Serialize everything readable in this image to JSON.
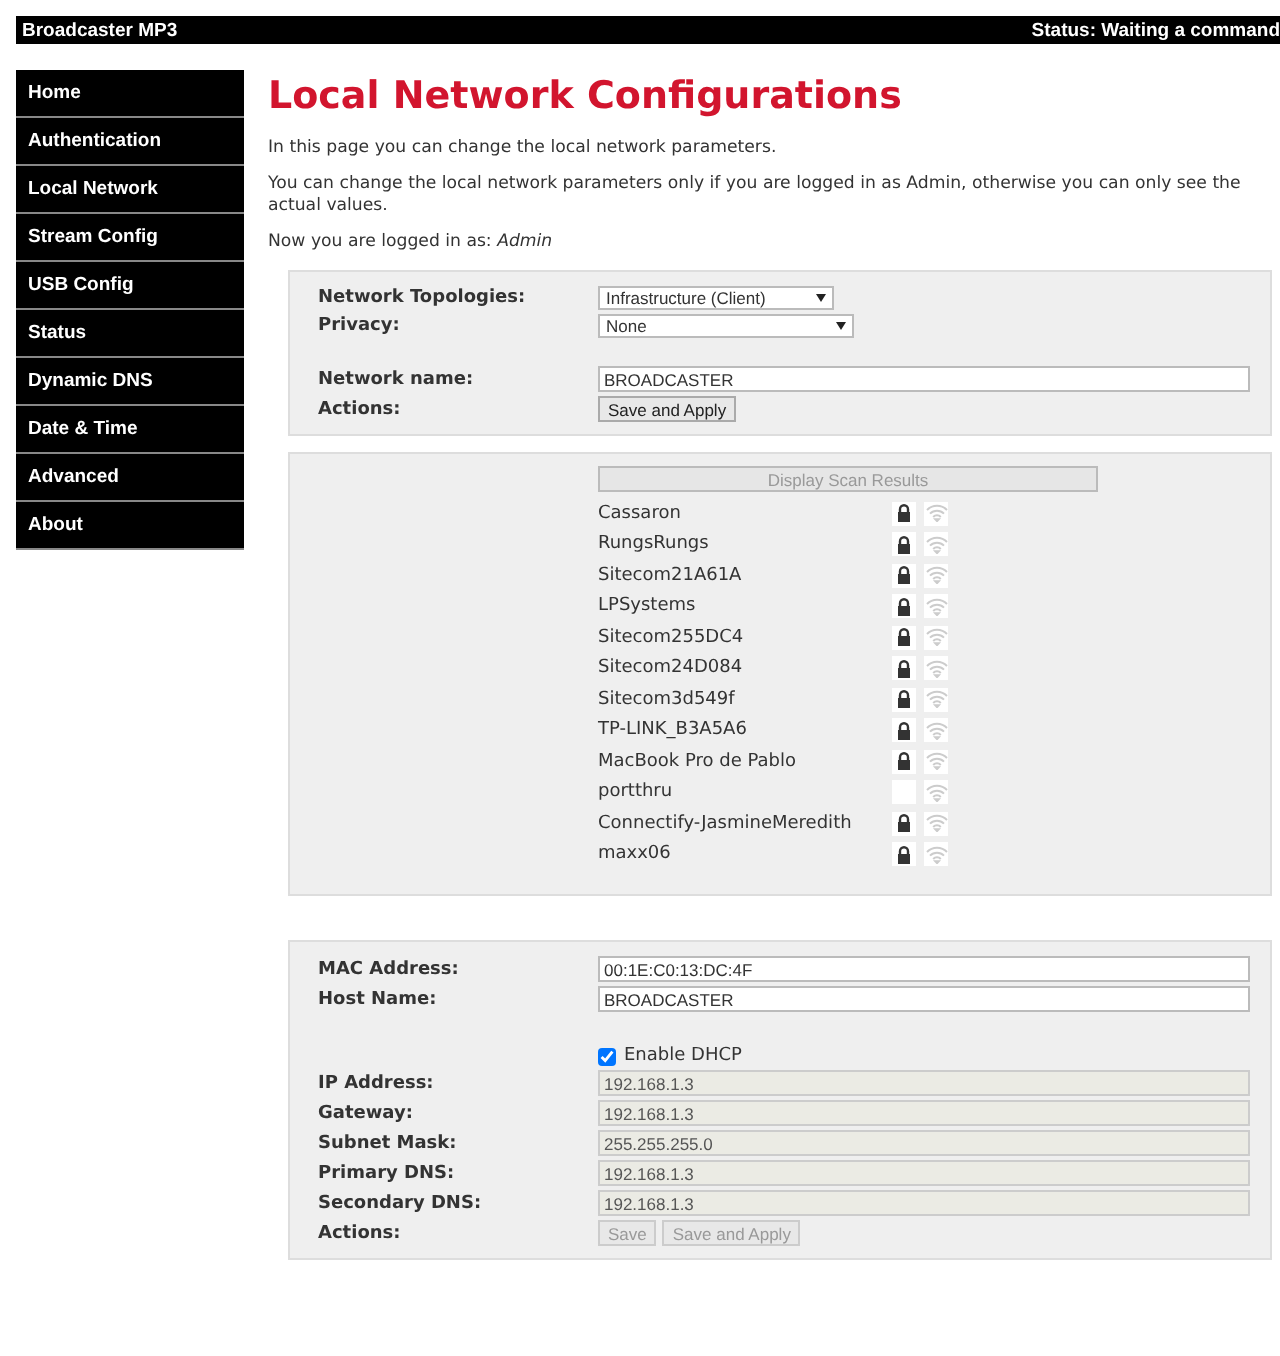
{
  "header": {
    "title": "Broadcaster MP3",
    "status": "Status:  Waiting a command"
  },
  "sidebar": {
    "items": [
      {
        "label": "Home"
      },
      {
        "label": "Authentication"
      },
      {
        "label": "Local Network"
      },
      {
        "label": "Stream Config"
      },
      {
        "label": "USB Config"
      },
      {
        "label": "Status"
      },
      {
        "label": "Dynamic DNS"
      },
      {
        "label": "Date & Time"
      },
      {
        "label": "Advanced"
      },
      {
        "label": "About"
      }
    ]
  },
  "page": {
    "title": "Local Network Configurations",
    "intro": [
      "In this page you can change the local network parameters.",
      "You can change the local network parameters only if you are logged in as Admin, otherwise you can only see the actual values."
    ],
    "login_label": "Now you are logged in as:",
    "login_user": "Admin"
  },
  "network_panel": {
    "groups": [
      [
        {
          "kind": "select",
          "label": "Network Topologies:",
          "value": "Infrastructure (Client)",
          "wide": false
        },
        {
          "kind": "select",
          "label": "Privacy:",
          "value": "None",
          "wide": true
        }
      ],
      [
        {
          "kind": "input",
          "label": "Network name:",
          "value": "BROADCASTER",
          "disabled": false
        },
        {
          "kind": "buttons",
          "label": "Actions:",
          "buttons": [
            {
              "label": "Save and Apply",
              "disabled": false
            }
          ]
        }
      ]
    ]
  },
  "scan_panel": {
    "button": {
      "label": "Display Scan Results",
      "disabled": true
    },
    "networks": [
      {
        "ssid": "Cassaron",
        "secured": true
      },
      {
        "ssid": "RungsRungs",
        "secured": true
      },
      {
        "ssid": "Sitecom21A61A",
        "secured": true
      },
      {
        "ssid": "LPSystems",
        "secured": true
      },
      {
        "ssid": "Sitecom255DC4",
        "secured": true
      },
      {
        "ssid": "Sitecom24D084",
        "secured": true
      },
      {
        "ssid": "Sitecom3d549f",
        "secured": true
      },
      {
        "ssid": "TP-LINK_B3A5A6",
        "secured": true
      },
      {
        "ssid": "MacBook Pro de Pablo",
        "secured": true
      },
      {
        "ssid": "portthru",
        "secured": false
      },
      {
        "ssid": "Connectify-JasmineMeredith",
        "secured": true
      },
      {
        "ssid": "maxx06",
        "secured": true
      }
    ]
  },
  "address_panel": {
    "groups": [
      [
        {
          "kind": "input",
          "label": "MAC Address:",
          "value": "00:1E:C0:13:DC:4F",
          "disabled": false
        },
        {
          "kind": "input",
          "label": "Host Name:",
          "value": "BROADCASTER",
          "disabled": false
        }
      ],
      [
        {
          "kind": "checkbox",
          "label": "Enable DHCP",
          "checked": true
        },
        {
          "kind": "input",
          "label": "IP Address:",
          "value": "192.168.1.3",
          "disabled": true
        },
        {
          "kind": "input",
          "label": "Gateway:",
          "value": "192.168.1.3",
          "disabled": true
        },
        {
          "kind": "input",
          "label": "Subnet Mask:",
          "value": "255.255.255.0",
          "disabled": true
        },
        {
          "kind": "input",
          "label": "Primary DNS:",
          "value": "192.168.1.3",
          "disabled": true
        },
        {
          "kind": "input",
          "label": "Secondary DNS:",
          "value": "192.168.1.3",
          "disabled": true
        },
        {
          "kind": "buttons",
          "label": "Actions:",
          "buttons": [
            {
              "label": "Save",
              "disabled": true
            },
            {
              "label": "Save and Apply",
              "disabled": true
            }
          ]
        }
      ]
    ]
  }
}
